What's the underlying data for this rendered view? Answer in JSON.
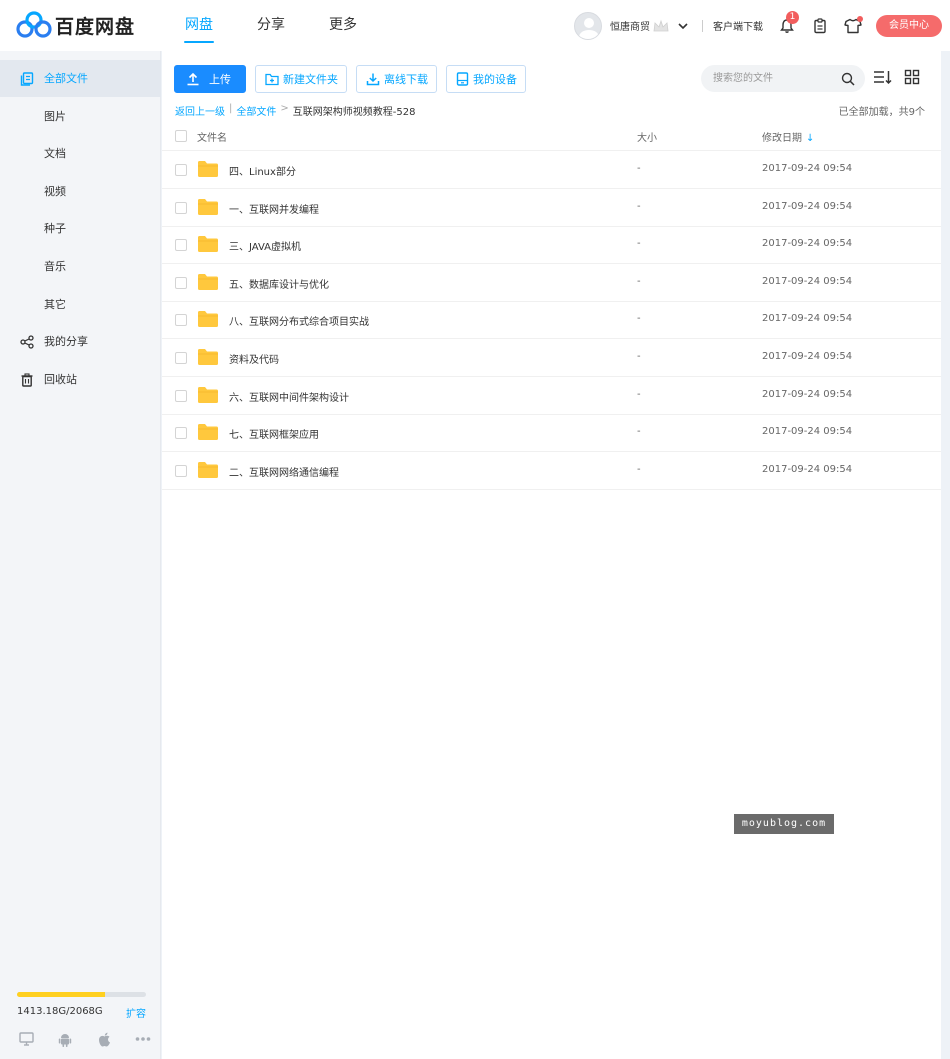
{
  "app": {
    "logo_text": "百度网盘"
  },
  "nav": [
    {
      "label": "网盘"
    },
    {
      "label": "分享"
    },
    {
      "label": "更多"
    }
  ],
  "user": {
    "name": "恒唐商贸",
    "client_download": "客户端下载",
    "notification_count": "1",
    "vip_label": "会员中心"
  },
  "sidebar": {
    "items": [
      {
        "label": "全部文件",
        "icon": "files-icon"
      },
      {
        "label": "图片"
      },
      {
        "label": "文档"
      },
      {
        "label": "视频"
      },
      {
        "label": "种子"
      },
      {
        "label": "音乐"
      },
      {
        "label": "其它"
      },
      {
        "label": "我的分享",
        "icon": "share-icon"
      },
      {
        "label": "回收站",
        "icon": "trash-icon"
      }
    ],
    "quota": {
      "text": "1413.18G/2068G",
      "used_fraction": 0.683,
      "expand_label": "扩容"
    }
  },
  "toolbar": {
    "upload": "上传",
    "new_folder": "新建文件夹",
    "offline_download": "离线下载",
    "my_devices": "我的设备"
  },
  "search": {
    "placeholder": "搜索您的文件",
    "value": ""
  },
  "breadcrumb": {
    "back": "返回上一级",
    "root": "全部文件",
    "current": "互联网架构师视频教程-528"
  },
  "status": "已全部加载，共9个",
  "table": {
    "headers": {
      "name": "文件名",
      "size": "大小",
      "date": "修改日期"
    },
    "rows": [
      {
        "name": "四、Linux部分",
        "size": "-",
        "date": "2017-09-24 09:54"
      },
      {
        "name": "一、互联网并发编程",
        "size": "-",
        "date": "2017-09-24 09:54"
      },
      {
        "name": "三、JAVA虚拟机",
        "size": "-",
        "date": "2017-09-24 09:54"
      },
      {
        "name": "五、数据库设计与优化",
        "size": "-",
        "date": "2017-09-24 09:54"
      },
      {
        "name": "八、互联网分布式综合项目实战",
        "size": "-",
        "date": "2017-09-24 09:54"
      },
      {
        "name": "资料及代码",
        "size": "-",
        "date": "2017-09-24 09:54"
      },
      {
        "name": "六、互联网中间件架构设计",
        "size": "-",
        "date": "2017-09-24 09:54"
      },
      {
        "name": "七、互联网框架应用",
        "size": "-",
        "date": "2017-09-24 09:54"
      },
      {
        "name": "二、互联网网络通信编程",
        "size": "-",
        "date": "2017-09-24 09:54"
      }
    ]
  },
  "watermark": "moyublog.com",
  "colors": {
    "accent": "#06a7ff",
    "primary_button": "#1a8cff",
    "vip": "#f56b6b",
    "folder": "#ffc83d",
    "quota_fill": "#ffd020"
  }
}
